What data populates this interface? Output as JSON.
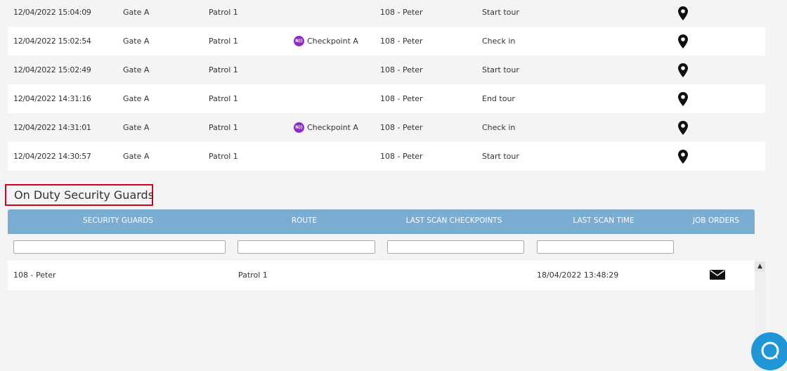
{
  "activity_log": {
    "rows": [
      {
        "time": "12/04/2022 15:04:09",
        "location": "Gate A",
        "route": "Patrol 1",
        "checkpoint": "",
        "guard": "108 - Peter",
        "event": "Start tour"
      },
      {
        "time": "12/04/2022 15:02:54",
        "location": "Gate A",
        "route": "Patrol 1",
        "checkpoint": "Checkpoint A",
        "guard": "108 - Peter",
        "event": "Check in"
      },
      {
        "time": "12/04/2022 15:02:49",
        "location": "Gate A",
        "route": "Patrol 1",
        "checkpoint": "",
        "guard": "108 - Peter",
        "event": "Start tour"
      },
      {
        "time": "12/04/2022 14:31:16",
        "location": "Gate A",
        "route": "Patrol 1",
        "checkpoint": "",
        "guard": "108 - Peter",
        "event": "End tour"
      },
      {
        "time": "12/04/2022 14:31:01",
        "location": "Gate A",
        "route": "Patrol 1",
        "checkpoint": "Checkpoint A",
        "guard": "108 - Peter",
        "event": "Check in"
      },
      {
        "time": "12/04/2022 14:30:57",
        "location": "Gate A",
        "route": "Patrol 1",
        "checkpoint": "",
        "guard": "108 - Peter",
        "event": "Start tour"
      }
    ]
  },
  "on_duty": {
    "title": "On Duty Security Guards",
    "headers": {
      "guards": "SECURITY GUARDS",
      "route": "ROUTE",
      "last_scan_checkpoints": "LAST SCAN CHECKPOINTS",
      "last_scan_time": "LAST SCAN TIME",
      "job_orders": "JOB ORDERS"
    },
    "filters": {
      "guards": "",
      "route": "",
      "checkpoints": "",
      "time": ""
    },
    "rows": [
      {
        "guard": "108 - Peter",
        "route": "Patrol 1",
        "last_checkpoint": "",
        "last_scan_time": "18/04/2022 13:48:29"
      }
    ]
  },
  "icons": {
    "map": "map-pin-icon",
    "nfc": "nfc-icon",
    "mail": "envelope-icon",
    "chat": "chat-bubble-icon",
    "scroll_up": "chevron-up-icon"
  },
  "colors": {
    "header_bg": "#7bacd1",
    "highlight_border": "#d0021b",
    "nfc_badge": "#8d2bc4",
    "chat_button": "#2196d6"
  }
}
